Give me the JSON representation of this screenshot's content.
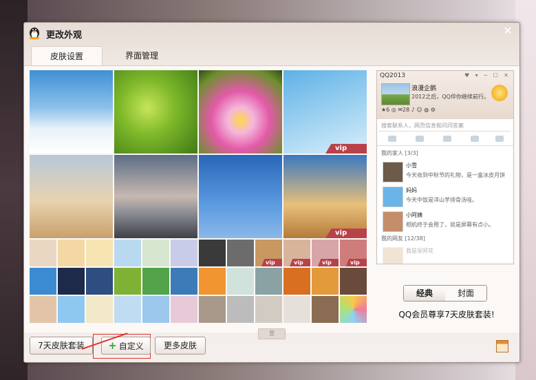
{
  "window": {
    "title": "更改外观",
    "close": "✕"
  },
  "tabs": [
    {
      "label": "皮肤设置",
      "active": true
    },
    {
      "label": "界面管理",
      "active": false
    }
  ],
  "skins": {
    "vip_label": "vip"
  },
  "preview": {
    "app_title": "QQ2013",
    "controls": "♥ ▾ ─ ☐ ✕",
    "nickname": "浪漫企鹅",
    "signature": "2012之后，QQ伴你继续前行。",
    "icons_row": "★6 ◎ ✉28 ♪ ☺ ◍ ⚙",
    "search_placeholder": "搜索联系人，网页信息和问问答案",
    "groups": [
      {
        "label": "我的家人 [3/3]"
      },
      {
        "label": "我的网友 [12/38]"
      }
    ],
    "contacts": [
      {
        "name": "小雪",
        "message": "今天收到中秋节的礼物，是一盒冰皮月饼"
      },
      {
        "name": "妈妈",
        "message": "今天中饭是洋山芋排骨汤哇。"
      },
      {
        "name": "小阿姨",
        "message": "相机终于会用了，就是屏幕有点小。"
      },
      {
        "name": "我是呆阿花",
        "message": ""
      }
    ]
  },
  "view_switch": {
    "classic": "经典",
    "cover": "封面"
  },
  "promo": "QQ会员尊享7天皮肤套装!",
  "splitter": "☰",
  "bottom": {
    "seven_day": "7天皮肤套装",
    "custom": "自定义",
    "more": "更多皮肤"
  },
  "colors": {
    "accent_red": "#e0302a",
    "vip_badge": "#b8424a",
    "plus_green": "#3aa335"
  }
}
